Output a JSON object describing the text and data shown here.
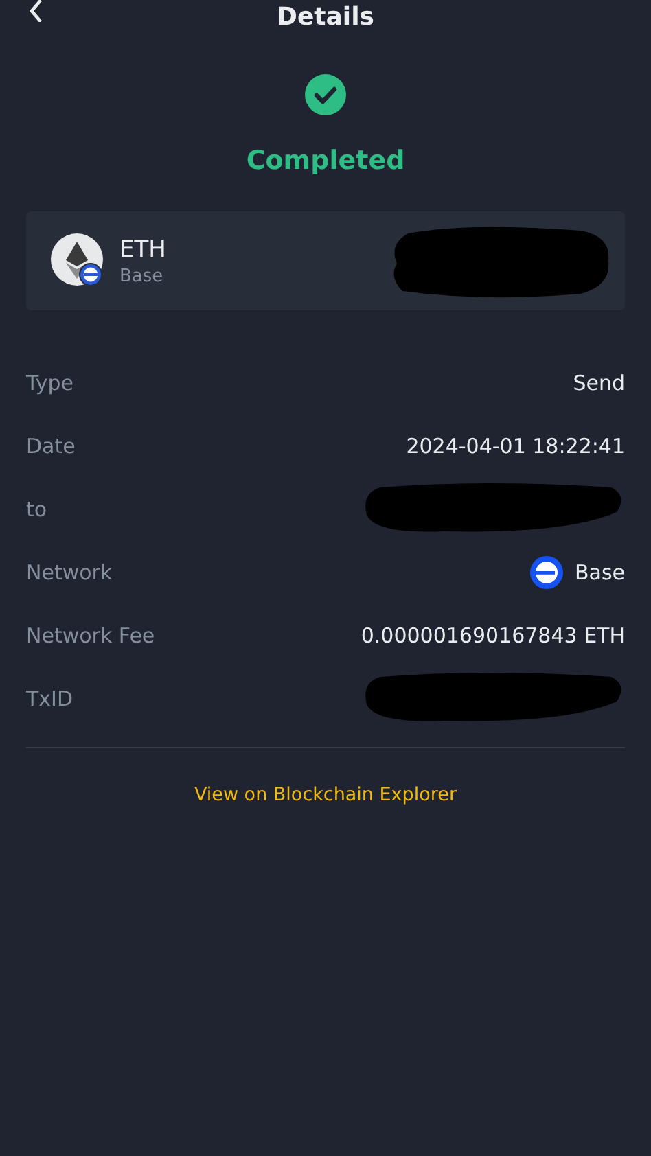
{
  "header": {
    "title": "Details"
  },
  "status": {
    "label": "Completed",
    "kind": "completed"
  },
  "asset": {
    "symbol": "ETH",
    "network": "Base",
    "address_redacted": true
  },
  "details": [
    {
      "label": "Type",
      "kind": "text",
      "value": "Send"
    },
    {
      "label": "Date",
      "kind": "text",
      "value": "2024-04-01 18:22:41"
    },
    {
      "label": "to",
      "kind": "redacted"
    },
    {
      "label": "Network",
      "kind": "network",
      "value": "Base"
    },
    {
      "label": "Network Fee",
      "kind": "text",
      "value": "0.000001690167843 ETH"
    },
    {
      "label": "TxID",
      "kind": "redacted"
    }
  ],
  "explorer_link": "View on Blockchain Explorer"
}
